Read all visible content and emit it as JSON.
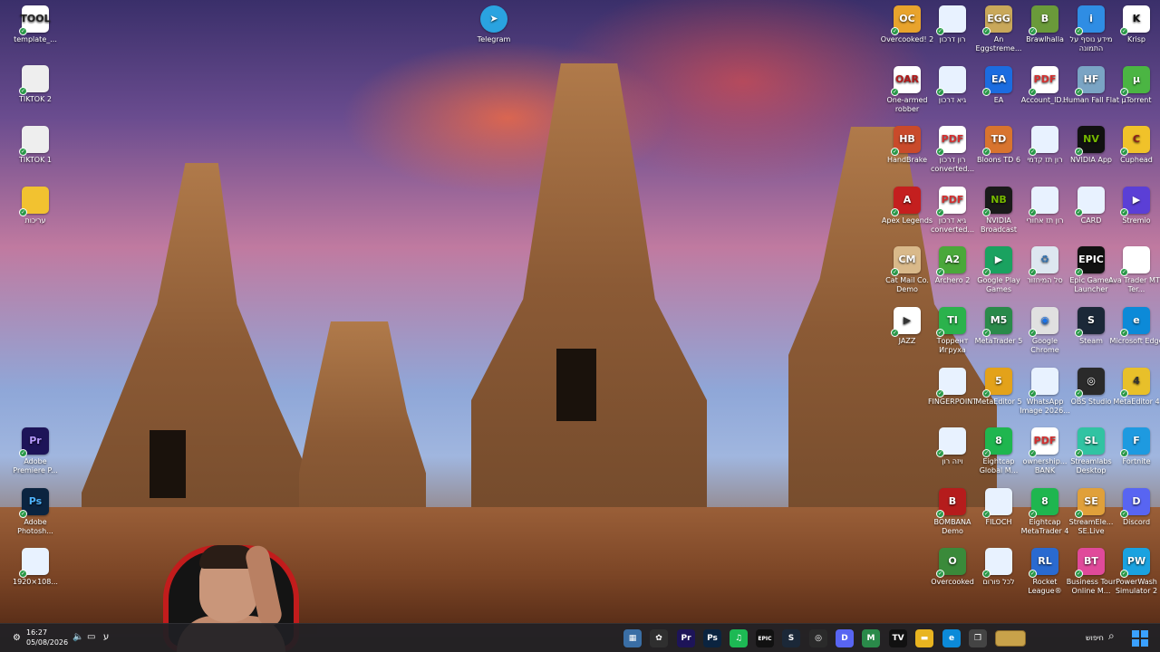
{
  "desktop": {
    "icons_left": [
      {
        "label": "template_...",
        "color": "#ffffff",
        "text": "TOOL",
        "fg": "#222"
      },
      {
        "label": "TIKTOK 2",
        "color": "#eeeeee",
        "text": "",
        "fg": "#222"
      },
      {
        "label": "TIKTOK 1",
        "color": "#eeeeee",
        "text": "",
        "fg": "#222"
      },
      {
        "label": "עריכות",
        "color": "#f2c230",
        "text": "",
        "fg": "#222"
      },
      {
        "label": "Adobe Premiere P...",
        "color": "#1d1458",
        "text": "Pr",
        "fg": "#b89cff"
      },
      {
        "label": "Adobe Photosh...",
        "color": "#0b2440",
        "text": "Ps",
        "fg": "#4fb4ff"
      },
      {
        "label": "1920×108...",
        "color": "#e8f2ff",
        "text": "",
        "fg": "#222"
      }
    ],
    "telegram": {
      "label": "Telegram",
      "color": "#2aa3e0"
    },
    "grid": [
      [
        {
          "label": "Overcooked! 2",
          "color": "#e8a32c",
          "text": "OC"
        },
        {
          "label": "רון דרכון",
          "color": "#e8f2ff",
          "text": ""
        },
        {
          "label": "An Eggstreme...",
          "color": "#c9a85a",
          "text": "EGG"
        },
        {
          "label": "Brawlhalla",
          "color": "#6a9a3a",
          "text": "B"
        },
        {
          "label": "מידע נוסף על התמונה",
          "color": "#2f8de4",
          "text": "i"
        },
        {
          "label": "Krisp",
          "color": "#ffffff",
          "text": "K",
          "fg": "#111"
        }
      ],
      [
        {
          "label": "One-armed robber",
          "color": "#ffffff",
          "text": "OAR",
          "fg": "#b01818"
        },
        {
          "label": "גיא דרכון",
          "color": "#e8f2ff",
          "text": ""
        },
        {
          "label": "EA",
          "color": "#1b6ce0",
          "text": "EA"
        },
        {
          "label": "Account_ID...",
          "color": "#ffffff",
          "text": "PDF",
          "fg": "#d32f2f"
        },
        {
          "label": "Human Fall Flat",
          "color": "#7aa4c4",
          "text": "HF"
        },
        {
          "label": "µTorrent",
          "color": "#4bb543",
          "text": "µ"
        }
      ],
      [
        {
          "label": "HandBrake",
          "color": "#c94a2a",
          "text": "HB"
        },
        {
          "label": "רון דרכון converted...",
          "color": "#ffffff",
          "text": "PDF",
          "fg": "#d32f2f"
        },
        {
          "label": "Bloons TD 6",
          "color": "#d8742e",
          "text": "TD"
        },
        {
          "label": "רון תז קדמי",
          "color": "#e8f2ff",
          "text": ""
        },
        {
          "label": "NVIDIA App",
          "color": "#111111",
          "text": "NV",
          "fg": "#76b900"
        },
        {
          "label": "Cuphead",
          "color": "#f0c22a",
          "text": "C",
          "fg": "#8a1c1c"
        }
      ],
      [
        {
          "label": "Apex Legends",
          "color": "#c41f1f",
          "text": "A"
        },
        {
          "label": "גיא דרכון converted...",
          "color": "#ffffff",
          "text": "PDF",
          "fg": "#d32f2f"
        },
        {
          "label": "NVIDIA Broadcast",
          "color": "#1a1a1a",
          "text": "NB",
          "fg": "#76b900"
        },
        {
          "label": "רון תז אחורי",
          "color": "#e8f2ff",
          "text": ""
        },
        {
          "label": "CARD",
          "color": "#e8f2ff",
          "text": ""
        },
        {
          "label": "Stremio",
          "color": "#5b3fd6",
          "text": "▶"
        }
      ],
      [
        {
          "label": "Cat Mail Co. Demo",
          "color": "#d9b98a",
          "text": "CM"
        },
        {
          "label": "Archero 2",
          "color": "#4aa83a",
          "text": "A2"
        },
        {
          "label": "Google Play Games",
          "color": "#1aa260",
          "text": "▶"
        },
        {
          "label": "סל המיחזור",
          "color": "#dde7f0",
          "text": "♻",
          "fg": "#2a6fb0"
        },
        {
          "label": "Epic Games Launcher",
          "color": "#111111",
          "text": "EPIC"
        },
        {
          "label": "Ava Trader MT4 Ter...",
          "color": "#ffffff",
          "text": ""
        }
      ],
      [
        {
          "label": "JAZZ",
          "color": "#ffffff",
          "text": "▶",
          "fg": "#333"
        },
        {
          "label": "Торрент Игруха",
          "color": "#2bb24c",
          "text": "TI"
        },
        {
          "label": "MetaTrader 5",
          "color": "#2a8a4a",
          "text": "M5"
        },
        {
          "label": "Google Chrome",
          "color": "#e0e0e0",
          "text": "◉",
          "fg": "#1a73e8"
        },
        {
          "label": "Steam",
          "color": "#1b2838",
          "text": "S"
        },
        {
          "label": "Microsoft Edge",
          "color": "#0c8ad8",
          "text": "e"
        }
      ],
      [
        {
          "label": "FINGERPOINT",
          "color": "#e8f2ff",
          "text": ""
        },
        {
          "label": "MetaEditor 5",
          "color": "#e3a21a",
          "text": "5"
        },
        {
          "label": "WhatsApp Image 2026...",
          "color": "#e8f2ff",
          "text": ""
        },
        {
          "label": "OBS Studio",
          "color": "#2a2a2a",
          "text": "◎"
        },
        {
          "label": "MetaEditor 4",
          "color": "#e8c02a",
          "text": "4",
          "fg": "#333"
        }
      ],
      [
        {
          "label": "ויזה רון",
          "color": "#e8f2ff",
          "text": ""
        },
        {
          "label": "Eightcap Global M...",
          "color": "#1fb64f",
          "text": "8"
        },
        {
          "label": "ownership... BANK",
          "color": "#ffffff",
          "text": "PDF",
          "fg": "#d32f2f"
        },
        {
          "label": "Streamlabs Desktop",
          "color": "#31c3a2",
          "text": "SL"
        },
        {
          "label": "Fortnite",
          "color": "#1e9ae0",
          "text": "F"
        }
      ],
      [
        {
          "label": "BOMBANA Demo",
          "color": "#b51c1c",
          "text": "B"
        },
        {
          "label": "FILOCH",
          "color": "#e8f2ff",
          "text": ""
        },
        {
          "label": "Eightcap MetaTrader 4",
          "color": "#1fb64f",
          "text": "8"
        },
        {
          "label": "StreamEle... SE.Live",
          "color": "#e0a03a",
          "text": "SE"
        },
        {
          "label": "Discord",
          "color": "#5865f2",
          "text": "D"
        }
      ],
      [
        {
          "label": "Overcooked",
          "color": "#3a8a3a",
          "text": "O"
        },
        {
          "label": "לכל פורום",
          "color": "#e8f2ff",
          "text": ""
        },
        {
          "label": "Rocket League®",
          "color": "#2a6ad0",
          "text": "RL"
        },
        {
          "label": "Business Tour Online M...",
          "color": "#e04a9a",
          "text": "BT"
        },
        {
          "label": "PowerWash Simulator 2",
          "color": "#1aa2e0",
          "text": "PW"
        }
      ]
    ]
  },
  "taskbar": {
    "time": "16:27",
    "date": "05/08/2026",
    "search_label": "חיפוש",
    "apps": [
      {
        "name": "calculator-app",
        "text": "▦",
        "color": "#3a6ea5"
      },
      {
        "name": "capcut-app",
        "text": "✿",
        "color": "#2f2f2f"
      },
      {
        "name": "premiere-app",
        "text": "Pr",
        "color": "#1d1458"
      },
      {
        "name": "photoshop-app",
        "text": "Ps",
        "color": "#0b2440"
      },
      {
        "name": "spotify-app",
        "text": "♫",
        "color": "#1db954"
      },
      {
        "name": "epic-app",
        "text": "EPIC",
        "color": "#111"
      },
      {
        "name": "steam-app",
        "text": "S",
        "color": "#1b2838"
      },
      {
        "name": "obs-app",
        "text": "◎",
        "color": "#2a2a2a"
      },
      {
        "name": "discord-app",
        "text": "D",
        "color": "#5865f2"
      },
      {
        "name": "metatrader-app",
        "text": "M",
        "color": "#2a8a4a"
      },
      {
        "name": "tradingview-app",
        "text": "TV",
        "color": "#111"
      },
      {
        "name": "file-explorer-app",
        "text": "▬",
        "color": "#e8b420"
      },
      {
        "name": "edge-app",
        "text": "e",
        "color": "#0c8ad8"
      },
      {
        "name": "taskview-app",
        "text": "❐",
        "color": "#444"
      }
    ]
  }
}
